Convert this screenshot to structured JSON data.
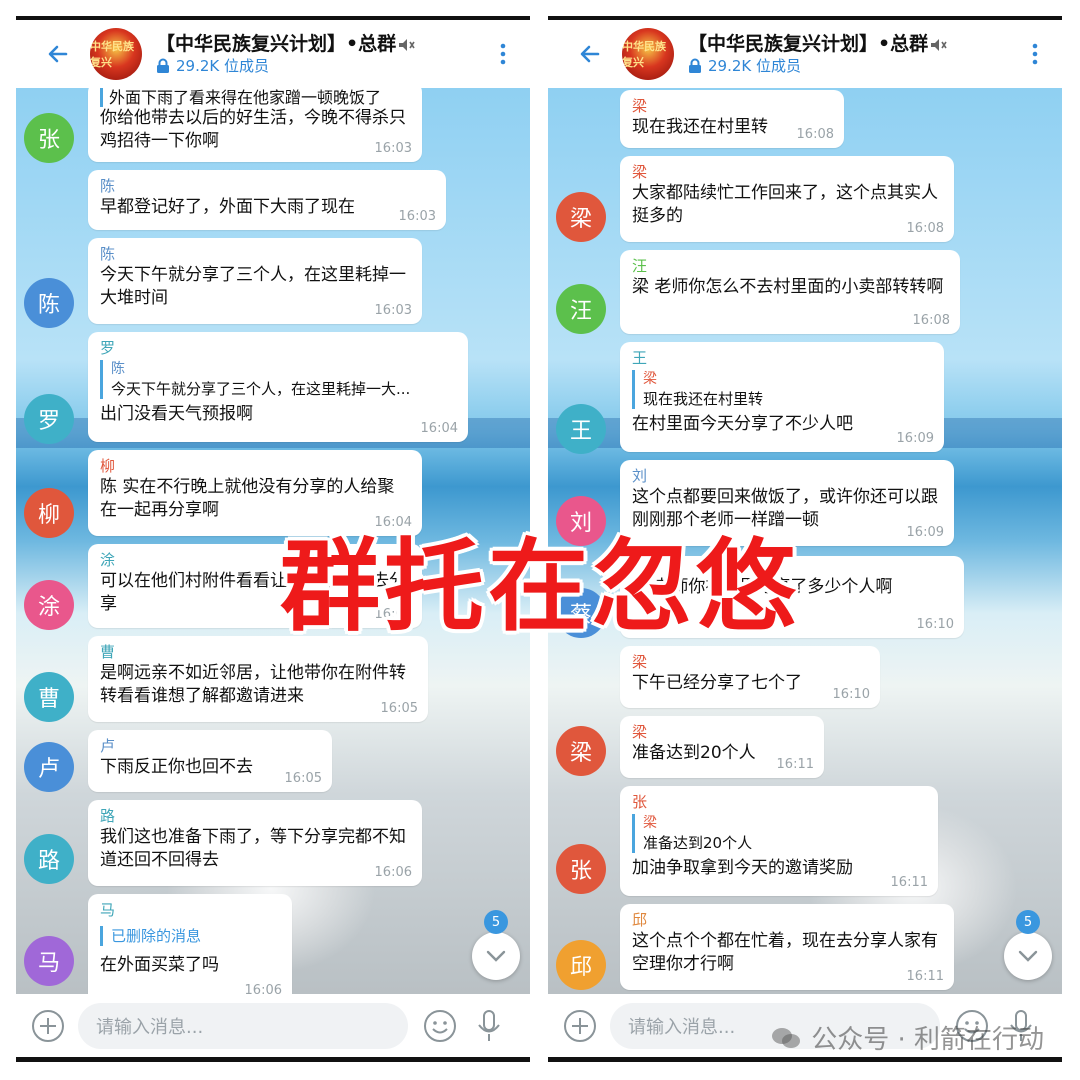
{
  "screens": [
    {
      "header": {
        "title": "【中华民族复兴计划】•总群",
        "members": "29.2K 位成员",
        "avatar_text": "中华民族复兴"
      },
      "input": {
        "placeholder": "请输入消息..."
      },
      "unread": "5",
      "messages": [
        {
          "avatar": "张",
          "color": "#5cc04c",
          "sender": "",
          "text": "外面下雨了看来得在他家蹭一顿晚饭了",
          "text2": "你给他带去以后的好生活，今晚不得杀只鸡招待一下你啊",
          "time": "16:03"
        },
        {
          "avatar": "",
          "color": "",
          "sender": "陈",
          "text": "早都登记好了，外面下大雨了现在",
          "time": "16:03"
        },
        {
          "avatar": "陈",
          "color": "#4a8fd8",
          "sender": "陈",
          "text": "今天下午就分享了三个人，在这里耗掉一大堆时间",
          "time": "16:03"
        },
        {
          "avatar": "罗",
          "color": "#3fb0c8",
          "sender": "罗",
          "quote_name": "陈",
          "quote": "今天下午就分享了三个人，在这里耗掉一大...",
          "text": "出门没看天气预报啊",
          "time": "16:04"
        },
        {
          "avatar": "柳",
          "color": "#e0573c",
          "sender": "柳",
          "text": "陈  实在不行晚上就他没有分享的人给聚在一起再分享啊",
          "time": "16:04"
        },
        {
          "avatar": "涂",
          "color": "#e9578c",
          "sender": "涂",
          "text": "可以在他们村附件看看让他带你一起去分享",
          "time": "16:05"
        },
        {
          "avatar": "曹",
          "color": "#3fb0c8",
          "sender": "曹",
          "text": "是啊远亲不如近邻居，让他带你在附件转转看看谁想了解都邀请进来",
          "time": "16:05"
        },
        {
          "avatar": "卢",
          "color": "#4a8fd8",
          "sender": "卢",
          "text": "下雨反正你也回不去",
          "time": "16:05"
        },
        {
          "avatar": "路",
          "color": "#3fb0c8",
          "sender": "路",
          "text": "我们这也准备下雨了，等下分享完都不知道还回不回得去",
          "time": "16:06"
        },
        {
          "avatar": "马",
          "color": "#a068d8",
          "sender": "马",
          "quote": "已删除的消息",
          "text": "在外面买菜了吗",
          "time": "16:06"
        }
      ]
    },
    {
      "header": {
        "title": "【中华民族复兴计划】•总群",
        "members": "29.2K 位成员",
        "avatar_text": "中华民族复兴"
      },
      "input": {
        "placeholder": "请输入消息..."
      },
      "unread": "5",
      "messages": [
        {
          "avatar": "",
          "color": "",
          "sender": "梁",
          "text": "现在我还在村里转",
          "time": "16:08"
        },
        {
          "avatar": "梁",
          "color": "#e0573c",
          "sender": "梁",
          "text": "大家都陆续忙工作回来了，这个点其实人挺多的",
          "time": "16:08"
        },
        {
          "avatar": "汪",
          "color": "#5cc04c",
          "sender": "汪",
          "text": "梁  老师你怎么不去村里面的小卖部转转啊",
          "time": "16:08"
        },
        {
          "avatar": "王",
          "color": "#3fb0c8",
          "sender": "王",
          "quote_name": "梁",
          "quote": "现在我还在村里转",
          "text": "在村里面今天分享了不少人吧",
          "time": "16:09"
        },
        {
          "avatar": "刘",
          "color": "#e9578c",
          "sender": "刘",
          "text": "这个点都要回来做饭了，或许你还可以跟刚刚那个老师一样蹭一顿",
          "time": "16:09"
        },
        {
          "avatar": "蔡",
          "color": "#4a8fd8",
          "sender": "",
          "text": "梁  老师你在村里分享了多少个人啊",
          "time": "16:10"
        },
        {
          "avatar": "",
          "color": "",
          "sender": "梁",
          "text": "下午已经分享了七个了",
          "time": "16:10"
        },
        {
          "avatar": "梁",
          "color": "#e0573c",
          "sender": "梁",
          "text": "准备达到20个人",
          "time": "16:11"
        },
        {
          "avatar": "张",
          "color": "#e0573c",
          "sender": "张",
          "quote_name": "梁",
          "quote": "准备达到20个人",
          "text": "加油争取拿到今天的邀请奖励",
          "time": "16:11"
        },
        {
          "avatar": "邱",
          "color": "#f0a030",
          "sender": "邱",
          "text": "这个点个个都在忙着，现在去分享人家有空理你才行啊",
          "time": "16:11"
        }
      ]
    }
  ],
  "overlay": {
    "text": "群托在忽悠"
  },
  "watermark": {
    "text": "公众号 · 利箭在行动"
  }
}
